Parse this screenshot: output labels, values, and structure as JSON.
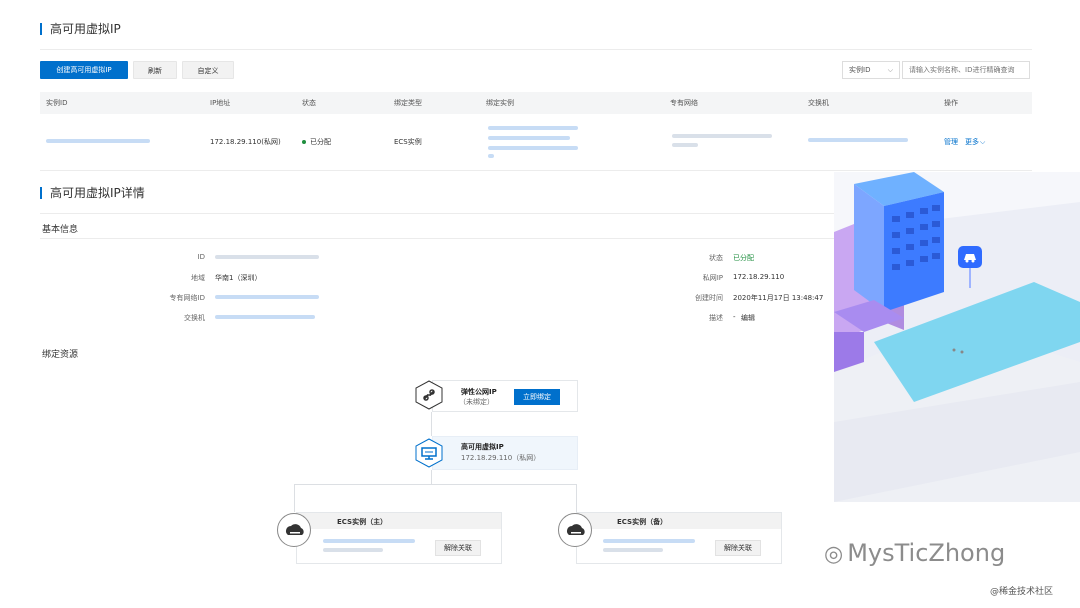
{
  "section1": {
    "title": "高可用虚拟IP"
  },
  "toolbar": {
    "create_label": "创建高可用虚拟IP",
    "refresh_label": "刷新",
    "custom_label": "自定义"
  },
  "search": {
    "select_value": "实例ID",
    "placeholder": "请输入实例名称、ID进行精确查询"
  },
  "table": {
    "columns": [
      "实例ID",
      "IP地址",
      "状态",
      "绑定类型",
      "绑定实例",
      "专有网络",
      "交换机",
      "操作"
    ],
    "row": {
      "ip": "172.18.29.110(私网)",
      "status": "已分配",
      "bind_type": "ECS实例",
      "action_manage": "管理",
      "action_more": "更多"
    }
  },
  "section2": {
    "title": "高可用虚拟IP详情"
  },
  "basic": {
    "title": "基本信息",
    "left": [
      {
        "label": "ID",
        "value": ""
      },
      {
        "label": "地域",
        "value": "华南1（深圳）"
      },
      {
        "label": "专有网络ID",
        "value": ""
      },
      {
        "label": "交换机",
        "value": ""
      }
    ],
    "right": [
      {
        "label": "状态",
        "value": "已分配"
      },
      {
        "label": "私网IP",
        "value": "172.18.29.110"
      },
      {
        "label": "创建时间",
        "value": "2020年11月17日 13:48:47"
      },
      {
        "label": "描述",
        "value": "-",
        "edit": "编辑"
      }
    ]
  },
  "binding": {
    "title": "绑定资源",
    "eip": {
      "title": "弹性公网IP",
      "sub": "（未绑定）",
      "button": "立即绑定"
    },
    "havip": {
      "title": "高可用虚拟IP",
      "sub": "172.18.29.110（私网）"
    },
    "ecs_main": {
      "title": "ECS实例（主）",
      "unlink": "解除关联"
    },
    "ecs_backup": {
      "title": "ECS实例（备）",
      "unlink": "解除关联"
    }
  },
  "watermark": {
    "text": "MysTicZhong",
    "sub": "@稀金技术社区"
  },
  "colors": {
    "primary": "#0070cc",
    "success": "#1e8e3e"
  }
}
